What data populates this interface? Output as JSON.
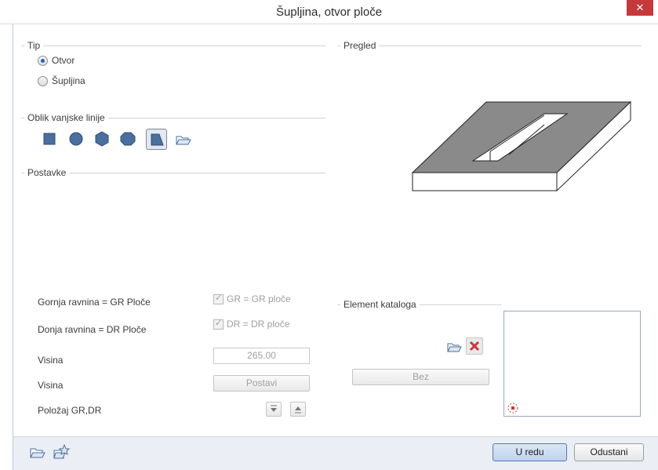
{
  "window": {
    "title": "Šupljina, otvor ploče",
    "close_glyph": "✕"
  },
  "tip": {
    "legend": "Tip",
    "options": [
      "Otvor",
      "Šupljina"
    ],
    "selected": "Otvor"
  },
  "outline": {
    "legend": "Oblik vanjske linije",
    "shapes": [
      "rectangle-icon",
      "circle-icon",
      "hexagon-icon",
      "octagon-icon",
      "polygon-icon",
      "open-from-file-icon"
    ],
    "active": "polygon-icon"
  },
  "settings": {
    "legend": "Postavke",
    "top_plane_label": "Gornja ravnina = GR Ploče",
    "top_plane_check": "GR = GR ploče",
    "bottom_plane_label": "Donja ravnina = DR Ploče",
    "bottom_plane_check": "DR = DR ploče",
    "height_label": "Visina",
    "height_value": "265.00",
    "height2_label": "Visina",
    "set_button": "Postavi",
    "position_label": "Položaj GR,DR"
  },
  "preview": {
    "legend": "Pregled"
  },
  "catalog": {
    "legend": "Element kataloga",
    "none_button": "Bez"
  },
  "footer": {
    "ok": "U redu",
    "cancel": "Odustani"
  },
  "colors": {
    "accent": "#2a63b5",
    "close": "#c7383a",
    "footer": "#ebeff5",
    "slab_top": "#8a8a8a"
  }
}
